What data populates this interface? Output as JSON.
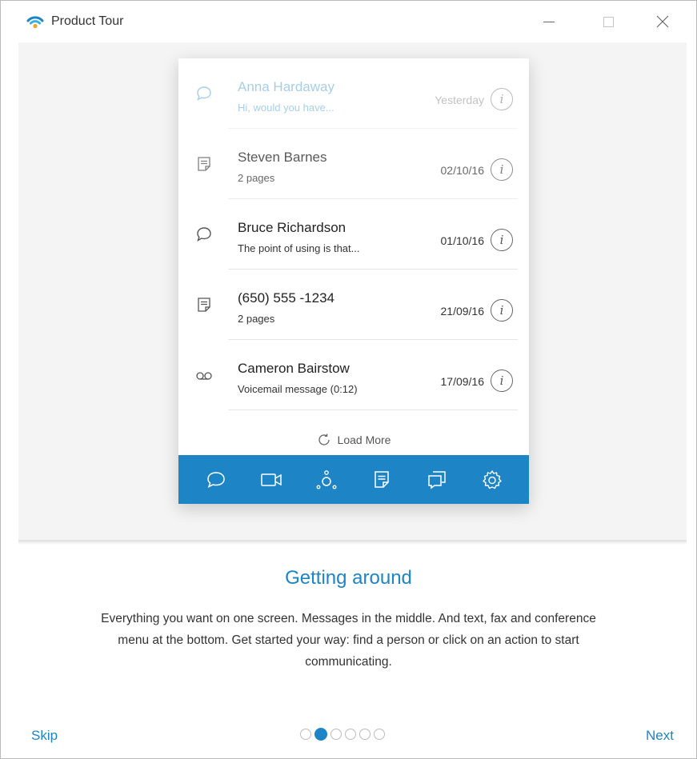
{
  "window": {
    "title": "Product Tour",
    "app_icon": "wifi-signal-icon",
    "controls": [
      "minimize-icon",
      "maximize-icon",
      "close-icon"
    ]
  },
  "preview": {
    "messages": [
      {
        "name": "Anna Hardaway",
        "sub": "Hi, would you have...",
        "date": "Yesterday",
        "icon": "chat-bubble-icon"
      },
      {
        "name": "Steven Barnes",
        "sub": "2 pages",
        "date": "02/10/16",
        "icon": "fax-document-icon"
      },
      {
        "name": "Bruce Richardson",
        "sub": "The point of using  is that...",
        "date": "01/10/16",
        "icon": "chat-bubble-icon"
      },
      {
        "name": "(650) 555 -1234",
        "sub": "2 pages",
        "date": "21/09/16",
        "icon": "fax-document-icon"
      },
      {
        "name": "Cameron Bairstow",
        "sub": "Voicemail message (0:12)",
        "date": "17/09/16",
        "icon": "voicemail-icon"
      }
    ],
    "info_glyph": "i",
    "load_more": "Load More",
    "bottom_bar_icons": [
      "chat-bubble-icon",
      "video-camera-icon",
      "contacts-icon",
      "fax-document-icon",
      "conference-icon",
      "settings-gear-icon"
    ]
  },
  "content": {
    "title": "Getting around",
    "body": "Everything you want on one screen. Messages in the middle. And text, fax and conference menu at the bottom. Get started your way: find a person or click on an action to start communicating."
  },
  "footer": {
    "skip": "Skip",
    "next": "Next",
    "total_pages": 6,
    "current_page": 2
  },
  "colors": {
    "accent": "#1d84c6",
    "preview_bg": "#f4f4f4"
  }
}
